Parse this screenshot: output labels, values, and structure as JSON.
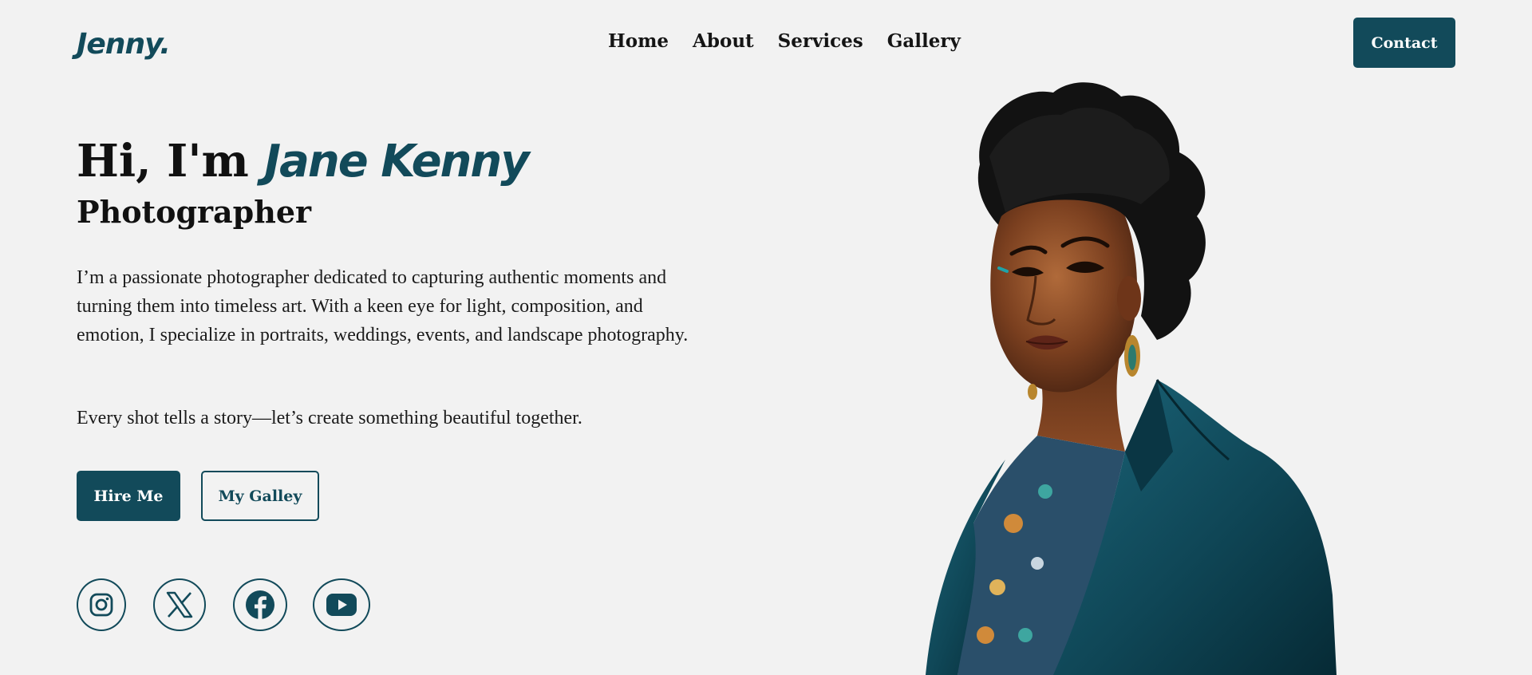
{
  "header": {
    "logo": "Jenny.",
    "nav": [
      "Home",
      "About",
      "Services",
      "Gallery"
    ],
    "contact_label": "Contact"
  },
  "hero": {
    "greeting": "Hi, I'm ",
    "name": "Jane Kenny",
    "subtitle": "Photographer",
    "bio": "I’m a passionate photographer dedicated to capturing authentic moments and turning them into timeless art. With a keen eye for light, composition, and emotion, I specialize in portraits, weddings, events, and landscape photography.",
    "tagline": "Every shot tells a story—let’s create something beautiful together.",
    "primary_cta": "Hire Me",
    "secondary_cta": "My Galley"
  },
  "socials": [
    {
      "icon": "instagram-icon"
    },
    {
      "icon": "x-icon"
    },
    {
      "icon": "facebook-icon"
    },
    {
      "icon": "youtube-icon"
    }
  ],
  "colors": {
    "accent": "#124a5a",
    "background": "#f2f2f2",
    "text": "#111111"
  }
}
